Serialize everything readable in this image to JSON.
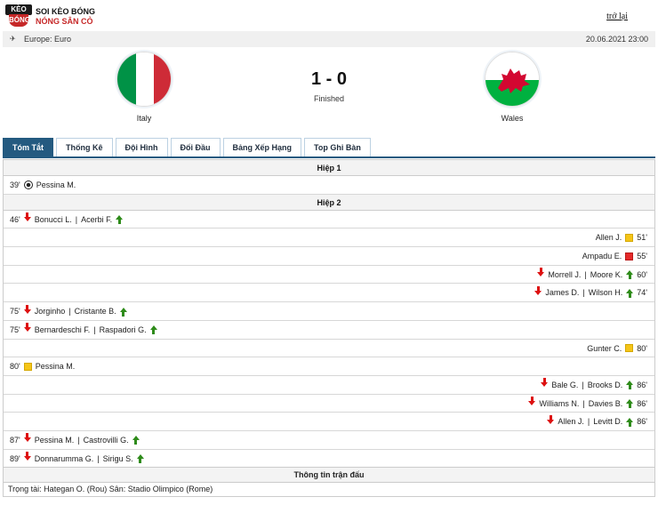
{
  "header": {
    "logo_top": "KÈO",
    "logo_bottom": "BÓNG",
    "brand_line1": "SOI KÈO BÓNG",
    "brand_line2": "NÓNG SÂN CỎ",
    "back_link": "trở lại"
  },
  "league": {
    "name": "Europe: Euro",
    "date": "20.06.2021 23:00",
    "icon": "globe-icon"
  },
  "match": {
    "home": "Italy",
    "away": "Wales",
    "score": "1 - 0",
    "status": "Finished"
  },
  "tabs": [
    {
      "label": "Tóm Tắt",
      "active": true
    },
    {
      "label": "Thống Kê",
      "active": false
    },
    {
      "label": "Đội Hình",
      "active": false
    },
    {
      "label": "Đối Đầu",
      "active": false
    },
    {
      "label": "Bảng Xếp Hạng",
      "active": false
    },
    {
      "label": "Top Ghi Bàn",
      "active": false
    }
  ],
  "sections": {
    "half1": "Hiệp 1",
    "half2": "Hiệp 2",
    "info": "Thông tin trận đấu"
  },
  "events": {
    "e1": {
      "minute": "39'",
      "player": "Pessina M."
    },
    "e2": {
      "minute": "46'",
      "out": "Bonucci L.",
      "in": "Acerbi F."
    },
    "e3": {
      "minute": "51'",
      "player": "Allen J."
    },
    "e4": {
      "minute": "55'",
      "player": "Ampadu E."
    },
    "e5": {
      "minute": "60'",
      "out": "Morrell J.",
      "in": "Moore K."
    },
    "e6": {
      "minute": "74'",
      "out": "James D.",
      "in": "Wilson H."
    },
    "e7": {
      "minute": "75'",
      "out": "Jorginho",
      "in": "Cristante B."
    },
    "e8": {
      "minute": "75'",
      "out": "Bernardeschi F.",
      "in": "Raspadori G."
    },
    "e9": {
      "minute": "80'",
      "player": "Gunter C."
    },
    "e10": {
      "minute": "80'",
      "player": "Pessina M."
    },
    "e11": {
      "minute": "86'",
      "out": "Bale G.",
      "in": "Brooks D."
    },
    "e12": {
      "minute": "86'",
      "out": "Williams N.",
      "in": "Davies B."
    },
    "e13": {
      "minute": "86'",
      "out": "Allen J.",
      "in": "Levitt D."
    },
    "e14": {
      "minute": "87'",
      "out": "Pessina M.",
      "in": "Castrovilli G."
    },
    "e15": {
      "minute": "89'",
      "out": "Donnarumma G.",
      "in": "Sirigu S."
    }
  },
  "info": {
    "text": "Trọng tài: Hategan O. (Rou) Sân: Stadio Olimpico (Rome)"
  },
  "colors": {
    "tab_active": "#245a80",
    "yellow_card": "#f5c518",
    "red_card": "#e52a2a",
    "sub_in": "#2e8b1a",
    "sub_out": "#d11111",
    "brand_red": "#c62828"
  }
}
